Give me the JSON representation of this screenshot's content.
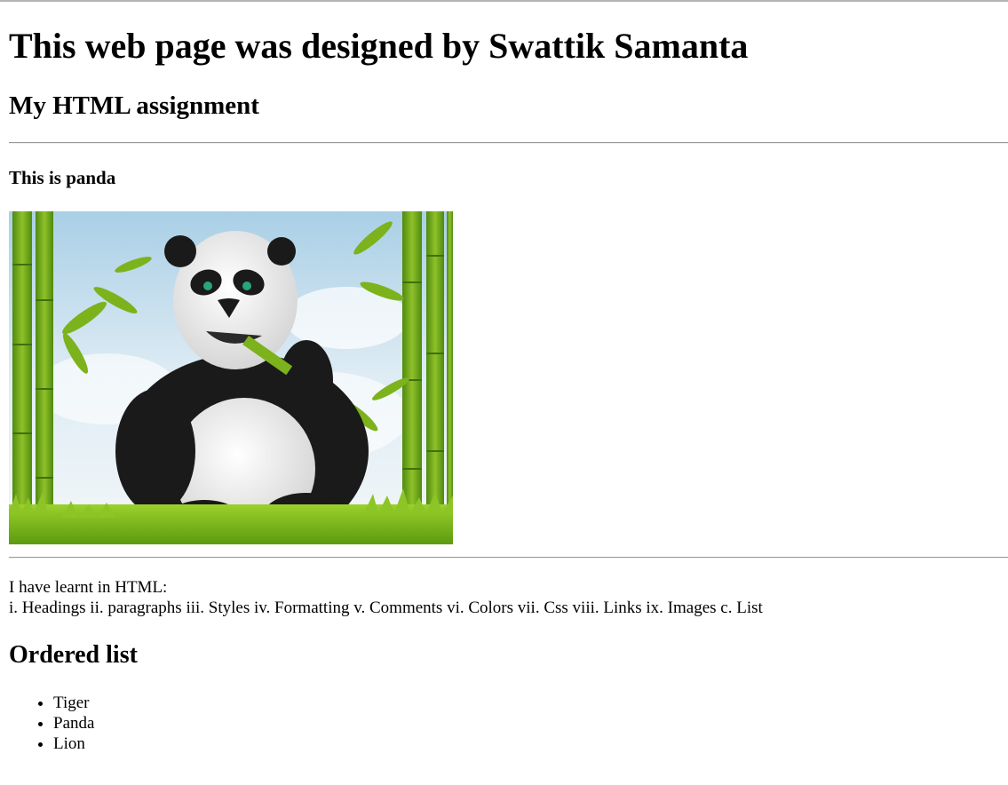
{
  "page": {
    "heading_main": "This web page was designed by Swattik Samanta",
    "heading_sub": "My HTML assignment",
    "image_caption_heading": "This is panda",
    "image": {
      "subject": "cartoon panda eating bamboo in a bamboo grove"
    },
    "learned_intro": "I have learnt in HTML:",
    "learned_list_line": "i. Headings ii. paragraphs iii. Styles iv. Formatting v. Comments vi. Colors vii. Css viii. Links ix. Images c. List",
    "ordered_list_heading": "Ordered list",
    "list_items": [
      "Tiger",
      "Panda",
      "Lion"
    ]
  },
  "colors": {
    "text": "#000000",
    "background": "#ffffff",
    "rule": "#9a9a9a",
    "bamboo": "#7cb21c",
    "sky": "#cfe3ef"
  }
}
